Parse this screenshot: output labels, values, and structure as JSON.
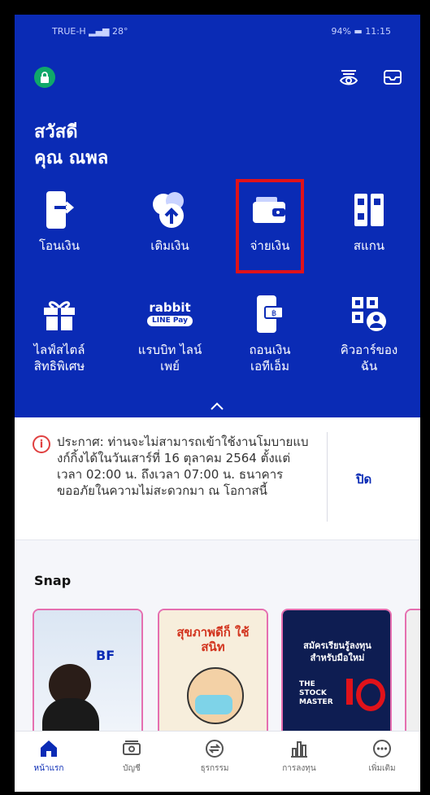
{
  "status_bar": {
    "carrier": "TRUE-H",
    "extras": "28°",
    "battery": "94%",
    "time": "11:15"
  },
  "greeting": {
    "line1": "สวัสดี",
    "line2": "คุณ ณพล"
  },
  "menu_row1": [
    {
      "label": "โอนเงิน",
      "icon": "transfer-phone-icon"
    },
    {
      "label": "เติมเงิน",
      "icon": "topup-icon"
    },
    {
      "label": "จ่ายเงิน",
      "icon": "wallet-icon"
    },
    {
      "label": "สแกน",
      "icon": "scan-icon"
    }
  ],
  "menu_row2": [
    {
      "label": "ไลฟ์สไตล์",
      "label2": "สิทธิพิเศษ",
      "icon": "gift-icon"
    },
    {
      "label": "แรบบิท ไลน์",
      "label2": "เพย์",
      "icon": "rabbit-linepay-icon",
      "logo_line1": "rabbit",
      "logo_line2": "LINE Pay"
    },
    {
      "label": "ถอนเงิน",
      "label2": "เอทีเอ็ม",
      "icon": "atm-withdraw-icon"
    },
    {
      "label": "คิวอาร์ของ",
      "label2": "ฉัน",
      "icon": "my-qr-icon"
    }
  ],
  "notice": {
    "text": "ประกาศ: ท่านจะไม่สามารถเข้าใช้งานโมบายแบงก์กิ้งได้ในวันเสาร์ที่ 16 ตุลาคม 2564 ตั้งแต่ เวลา 02:00 น. ถึงเวลา 07:00 น. ธนาคารขออภัยในความไม่สะดวกมา ณ โอกาสนี้",
    "close_label": "ปิด"
  },
  "snap": {
    "title": "Snap",
    "cards": [
      {
        "name": "snap-card-bf",
        "text": "BF"
      },
      {
        "name": "snap-card-cartoon",
        "text": "สุขภาพดีก็ ใช้สนิท"
      },
      {
        "name": "snap-card-stock",
        "text": "สมัครเรียนรู้ลงทุน สำหรับมือใหม่",
        "sub": "THE STOCK MASTER"
      }
    ]
  },
  "bottom_nav": [
    {
      "label": "หน้าแรก",
      "icon": "home-icon",
      "active": true
    },
    {
      "label": "บัญชี",
      "icon": "account-icon"
    },
    {
      "label": "ธุรกรรม",
      "icon": "transaction-icon"
    },
    {
      "label": "การลงทุน",
      "icon": "invest-icon"
    },
    {
      "label": "เพิ่มเติม",
      "icon": "more-icon"
    }
  ],
  "colors": {
    "primary": "#0a2bb5",
    "highlight": "#e0121a",
    "lock": "#0fa86a"
  }
}
